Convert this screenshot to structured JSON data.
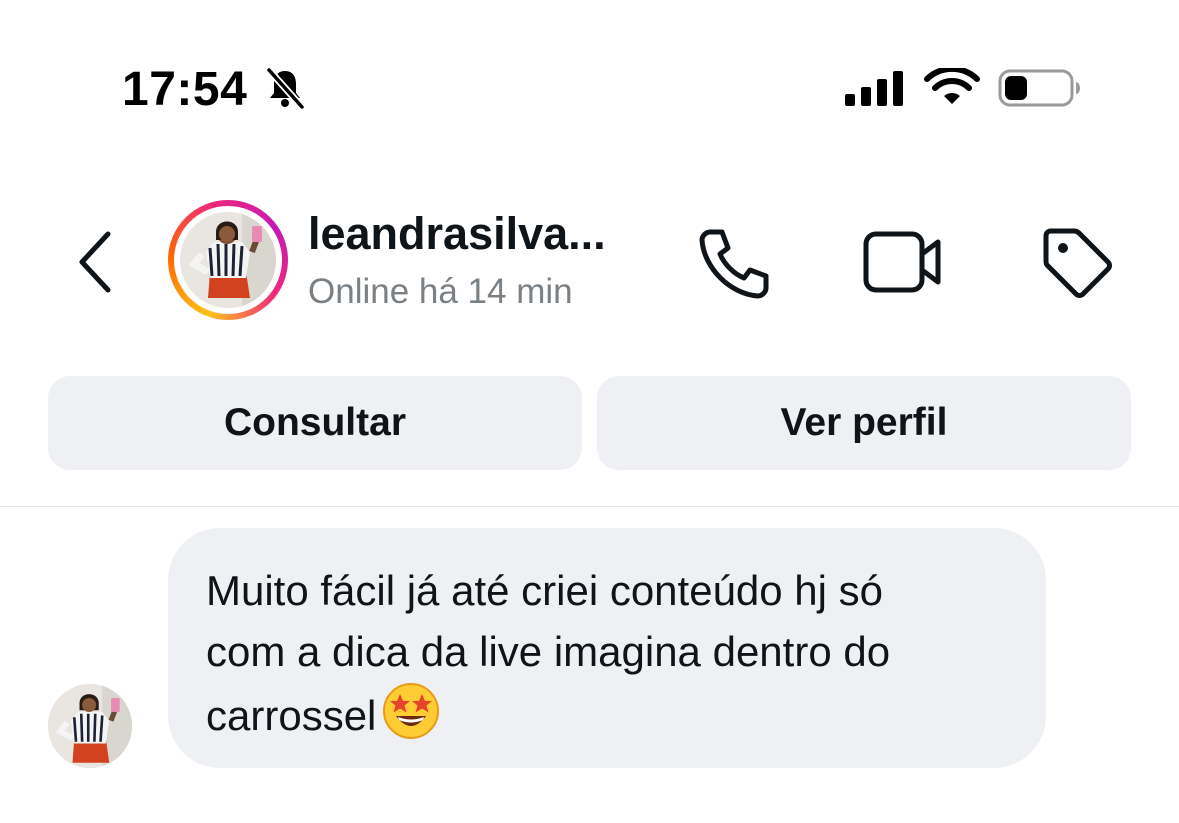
{
  "status_bar": {
    "time": "17:54",
    "icons": [
      "bell-slash-icon",
      "cellular-signal-icon",
      "wifi-icon",
      "battery-icon"
    ]
  },
  "header": {
    "username": "leandrasilva...",
    "presence": "Online há 14 min",
    "icons": [
      "back-chevron-icon",
      "phone-icon",
      "video-camera-icon",
      "tag-icon"
    ],
    "story_ring_colors": [
      "#fdc21a",
      "#ff6a00",
      "#ee2a7b",
      "#c519b2"
    ]
  },
  "actions": {
    "consult_label": "Consultar",
    "profile_label": "Ver perfil"
  },
  "messages": [
    {
      "text": "Muito fácil já até criei conteúdo hj só\ncom a dica da live imagina dentro do\ncarrossel",
      "emoji": "star-struck-emoji"
    }
  ],
  "colors": {
    "bubble_bg": "#eff0f4",
    "button_bg": "#eff0f4",
    "secondary_text": "#7b8085"
  }
}
